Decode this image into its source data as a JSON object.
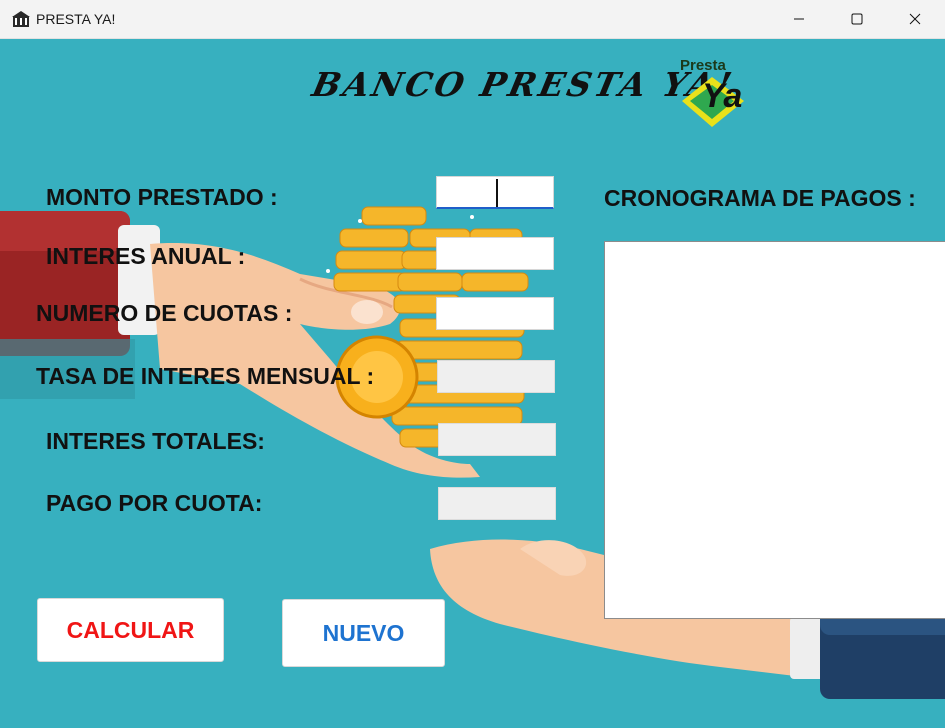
{
  "window": {
    "title": "PRESTA YA!",
    "controls": {
      "minimize_icon": "minimize-icon",
      "maximize_icon": "maximize-icon",
      "close_icon": "close-icon"
    }
  },
  "header": {
    "banner": "BANCO PRESTA YA!",
    "logo_text": "Presta",
    "logo_glyph": "Ya"
  },
  "form": {
    "monto_label": "MONTO PRESTADO :",
    "interes_anual_label": "INTERES ANUAL :",
    "cuotas_label": "NUMERO DE CUOTAS :",
    "tasa_label": "TASA DE INTERES MENSUAL :",
    "interes_totales_label": "INTERES TOTALES:",
    "pago_label": "PAGO POR CUOTA:",
    "monto_value": "",
    "interes_anual_value": "",
    "cuotas_value": "",
    "tasa_value": "",
    "interes_totales_value": "",
    "pago_value": ""
  },
  "schedule": {
    "label": "CRONOGRAMA DE PAGOS :",
    "content": ""
  },
  "buttons": {
    "calcular": "CALCULAR",
    "nuevo": "NUEVO"
  },
  "colors": {
    "background": "#37b0bf",
    "calcular_text": "#f01515",
    "nuevo_text": "#1e73d0",
    "sleeve_red": "#9a2424",
    "sleeve_blue": "#1f3f66",
    "coin_gold": "#f5b62a"
  }
}
